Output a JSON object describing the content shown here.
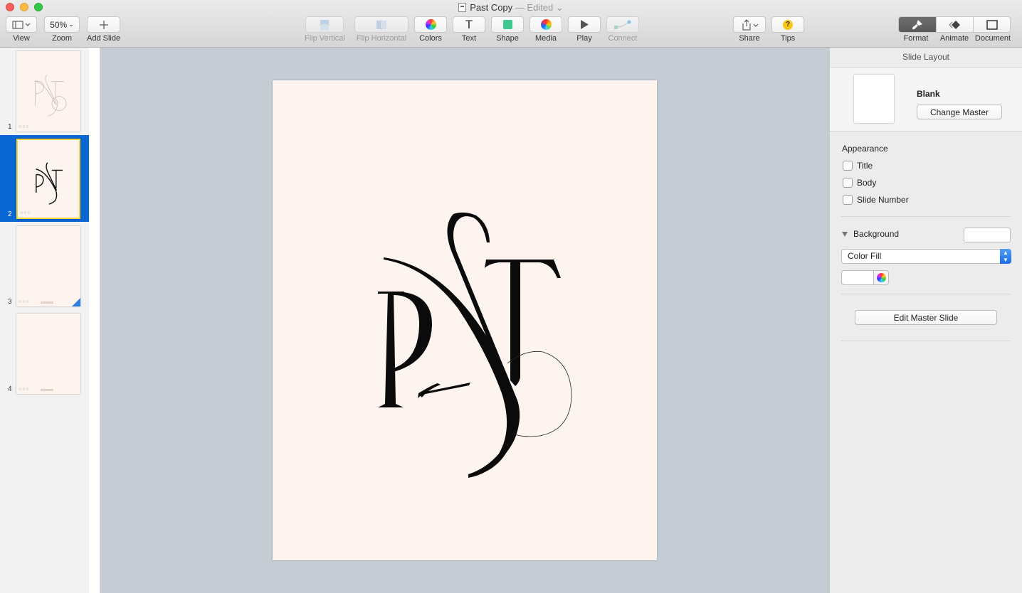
{
  "window": {
    "title": "Past Copy",
    "edited": "— Edited"
  },
  "toolbar": {
    "view_label": "View",
    "zoom_value": "50%",
    "zoom_label": "Zoom",
    "add_slide_label": "Add Slide",
    "flip_vertical_label": "Flip Vertical",
    "flip_horizontal_label": "Flip Horizontal",
    "colors_label": "Colors",
    "text_label": "Text",
    "text_glyph": "T",
    "shape_label": "Shape",
    "media_label": "Media",
    "play_label": "Play",
    "connect_label": "Connect",
    "share_label": "Share",
    "tips_label": "Tips",
    "tips_glyph": "?",
    "format_label": "Format",
    "animate_label": "Animate",
    "document_label": "Document"
  },
  "navigator": {
    "slides": [
      {
        "number": "1",
        "dots": "○○○"
      },
      {
        "number": "2",
        "dots": "○○○",
        "selected": true
      },
      {
        "number": "3",
        "dots": "○○○"
      },
      {
        "number": "4",
        "dots": "○○○"
      }
    ]
  },
  "slide": {
    "background_color": "#fdf4ef",
    "artwork": "PAST monogram"
  },
  "inspector": {
    "header": "Slide Layout",
    "master_name": "Blank",
    "change_master_label": "Change Master",
    "appearance_title": "Appearance",
    "checkboxes": [
      {
        "label": "Title",
        "checked": false
      },
      {
        "label": "Body",
        "checked": false
      },
      {
        "label": "Slide Number",
        "checked": false
      }
    ],
    "background_title": "Background",
    "fill_type": "Color Fill",
    "edit_master_label": "Edit Master Slide"
  },
  "colors": {
    "selection_blue": "#0a66d3",
    "thumb_highlight": "#f4d43a",
    "canvas_bg": "#c5ccd4"
  }
}
